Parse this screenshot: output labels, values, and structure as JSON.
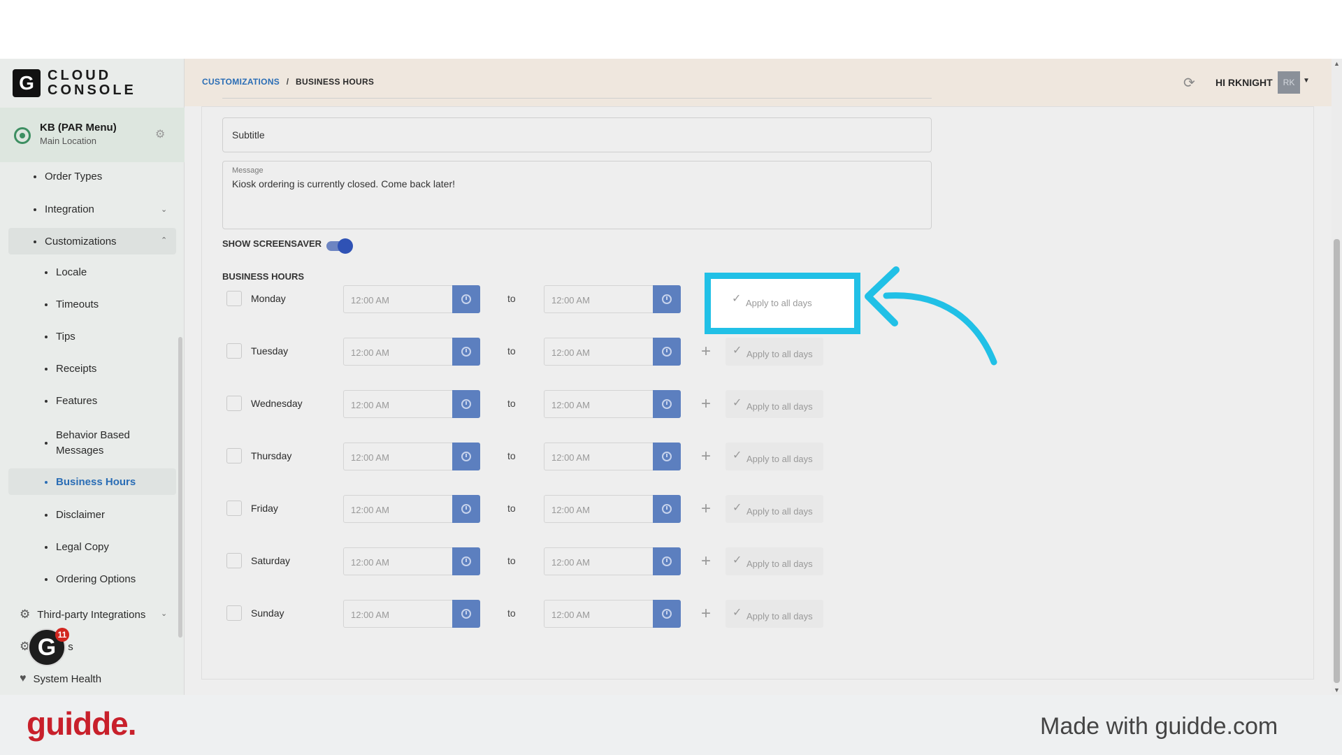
{
  "logo": {
    "mark": "G",
    "line1": "CLOUD",
    "line2": "CONSOLE"
  },
  "location": {
    "name": "KB (PAR Menu)",
    "sub": "Main Location"
  },
  "sidebar": {
    "items": [
      {
        "label": "Order Types"
      },
      {
        "label": "Integration"
      },
      {
        "label": "Customizations"
      },
      {
        "label": "Locale"
      },
      {
        "label": "Timeouts"
      },
      {
        "label": "Tips"
      },
      {
        "label": "Receipts"
      },
      {
        "label": "Features"
      },
      {
        "label": "Behavior Based"
      },
      {
        "label": "Messages"
      },
      {
        "label": "Business Hours"
      },
      {
        "label": "Disclaimer"
      },
      {
        "label": "Legal Copy"
      },
      {
        "label": "Ordering Options"
      },
      {
        "label": "Third-party Integrations"
      },
      {
        "label": "s"
      },
      {
        "label": "System Health"
      }
    ],
    "badge_count": "11"
  },
  "header": {
    "crumb_link": "CUSTOMIZATIONS",
    "crumb_sep": "/",
    "crumb_current": "BUSINESS HOURS",
    "greeting": "HI RKNIGHT",
    "avatar": "RK"
  },
  "form": {
    "subtitle_placeholder": "Subtitle",
    "message_label": "Message",
    "message_value": "Kiosk ordering is currently closed. Come back later!",
    "screensaver_label": "SHOW SCREENSAVER",
    "business_hours_label": "BUSINESS HOURS"
  },
  "days": [
    {
      "day": "Monday",
      "from": "12:00 AM",
      "to_label": "to",
      "to": "12:00 AM",
      "apply": "Apply to all days"
    },
    {
      "day": "Tuesday",
      "from": "12:00 AM",
      "to_label": "to",
      "to": "12:00 AM",
      "apply": "Apply to all days"
    },
    {
      "day": "Wednesday",
      "from": "12:00 AM",
      "to_label": "to",
      "to": "12:00 AM",
      "apply": "Apply to all days"
    },
    {
      "day": "Thursday",
      "from": "12:00 AM",
      "to_label": "to",
      "to": "12:00 AM",
      "apply": "Apply to all days"
    },
    {
      "day": "Friday",
      "from": "12:00 AM",
      "to_label": "to",
      "to": "12:00 AM",
      "apply": "Apply to all days"
    },
    {
      "day": "Saturday",
      "from": "12:00 AM",
      "to_label": "to",
      "to": "12:00 AM",
      "apply": "Apply to all days"
    },
    {
      "day": "Sunday",
      "from": "12:00 AM",
      "to_label": "to",
      "to": "12:00 AM",
      "apply": "Apply to all days"
    }
  ],
  "footer": {
    "brand": "guidde.",
    "made_with": "Made with guidde.com"
  },
  "colors": {
    "accent": "#2a6db5",
    "highlight": "#21c0e6",
    "brand": "#c8202b"
  }
}
